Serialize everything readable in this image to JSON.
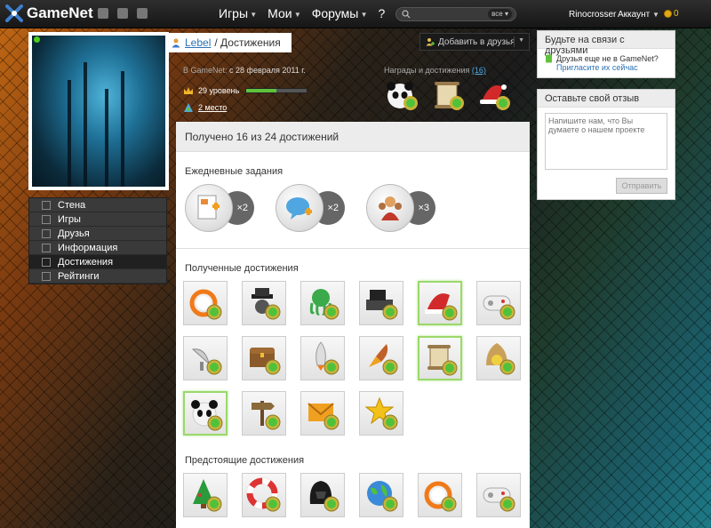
{
  "header": {
    "logo": "GameNet",
    "nav": [
      "Игры",
      "Мои",
      "Форумы",
      "?"
    ],
    "search_scope": "все",
    "username": "Rinocrosser",
    "account": "Аккаунт",
    "coins": "0"
  },
  "profile": {
    "name": "Lebel",
    "section": "/ Достижения",
    "member_since_label": "В GameNet:",
    "member_since_value": "с 28 февраля 2011 г.",
    "level": "29 уровень",
    "level_progress": 0.5,
    "place": "2 место",
    "add_friend": "Добавить в друзья",
    "awards_label": "Награды и достижения",
    "awards_count": "(16)"
  },
  "sidebar": {
    "items": [
      "Стена",
      "Игры",
      "Друзья",
      "Информация",
      "Достижения",
      "Рейтинги"
    ],
    "active_index": 4
  },
  "achievements": {
    "summary": "Получено 16 из 24 достижений",
    "daily_title": "Ежедневные задания",
    "daily": [
      {
        "icon": "document-icon",
        "mult": "×2"
      },
      {
        "icon": "speech-bubble-icon",
        "mult": "×2"
      },
      {
        "icon": "people-icon",
        "mult": "×3"
      }
    ],
    "received_title": "Полученные достижения",
    "received": [
      {
        "icon": "fire-ring-icon",
        "hl": false
      },
      {
        "icon": "spy-icon",
        "hl": false
      },
      {
        "icon": "octopus-icon",
        "hl": false
      },
      {
        "icon": "keyboard-icon",
        "hl": false
      },
      {
        "icon": "santa-hat-icon",
        "hl": true
      },
      {
        "icon": "gamepad-icon",
        "hl": false
      },
      {
        "icon": "satellite-dish-icon",
        "hl": false
      },
      {
        "icon": "treasure-chest-icon",
        "hl": false
      },
      {
        "icon": "rocket-icon",
        "hl": false
      },
      {
        "icon": "rocket-launch-icon",
        "hl": false
      },
      {
        "icon": "scroll-icon",
        "hl": true
      },
      {
        "icon": "bell-icon",
        "hl": false
      },
      {
        "icon": "panda-icon",
        "hl": true
      },
      {
        "icon": "signpost-icon",
        "hl": false
      },
      {
        "icon": "envelope-icon",
        "hl": false
      },
      {
        "icon": "star-icon",
        "hl": false
      }
    ],
    "upcoming_title": "Предстоящие достижения",
    "upcoming": [
      {
        "icon": "christmas-tree-icon"
      },
      {
        "icon": "lifebuoy-icon"
      },
      {
        "icon": "darth-vader-icon"
      },
      {
        "icon": "globe-icon"
      },
      {
        "icon": "fire-ring-icon"
      },
      {
        "icon": "gamepad-icon"
      }
    ]
  },
  "right": {
    "friends_title": "Будьте на связи с друзьями",
    "friends_text": "Друзья еще не в GameNet?",
    "friends_link": "Пригласите их сейчас",
    "feedback_title": "Оставьте свой отзыв",
    "feedback_placeholder": "Напишите нам, что Вы думаете о нашем проекте",
    "send": "Отправить"
  },
  "colors": {
    "accent_link": "#2a72b5",
    "online": "#4cd01e",
    "xp": "#5fc23a",
    "highlight": "#9bd86a"
  }
}
